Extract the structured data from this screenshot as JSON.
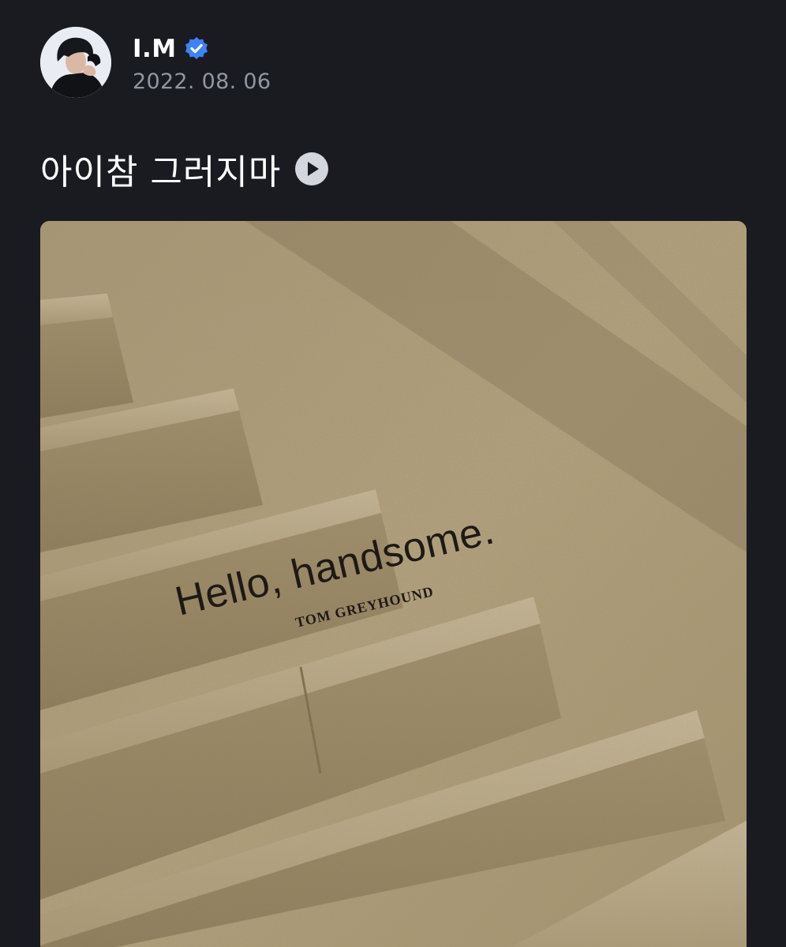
{
  "post": {
    "author": {
      "name": "I.M",
      "verified": true,
      "avatar_icon": "profile-photo"
    },
    "date": "2022. 08. 06",
    "caption": "아이참 그러지마",
    "caption_icon": "play-circle-icon",
    "photo": {
      "text_main": "Hello, handsome.",
      "text_sub": "TOM GREYHOUND"
    }
  },
  "colors": {
    "background": "#1a1b20",
    "verified_badge": "#3d82f6",
    "date_text": "#9097a3",
    "play_icon": "#d3d6dc"
  }
}
